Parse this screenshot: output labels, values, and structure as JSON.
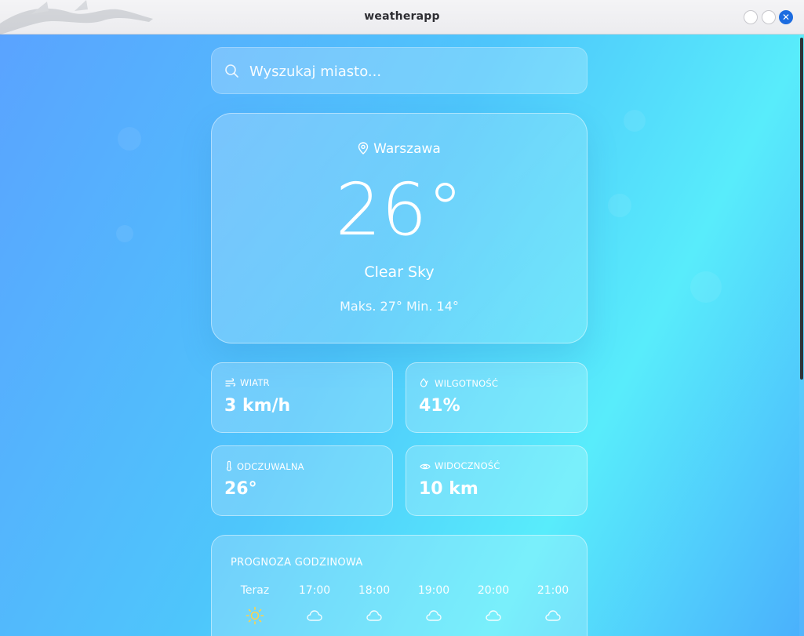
{
  "window": {
    "title": "weatherapp"
  },
  "search": {
    "placeholder": "Wyszukaj miasto...",
    "icon": "search-icon"
  },
  "current": {
    "location_icon": "map-pin-icon",
    "city": "Warszawa",
    "temperature": "26°",
    "condition": "Clear Sky",
    "minmax": "Maks. 27° Min. 14°"
  },
  "stats": [
    {
      "icon": "wind-icon",
      "label": "WIATR",
      "value": "3 km/h"
    },
    {
      "icon": "droplets-icon",
      "label": "WILGOTNOŚĆ",
      "value": "41%"
    },
    {
      "icon": "thermometer-icon",
      "label": "ODCZUWALNA",
      "value": "26°"
    },
    {
      "icon": "eye-icon",
      "label": "WIDOCZNOŚĆ",
      "value": "10 km"
    }
  ],
  "hourly": {
    "title": "PROGNOZA GODZINOWA",
    "items": [
      {
        "time": "Teraz",
        "icon": "sun-icon"
      },
      {
        "time": "17:00",
        "icon": "cloud-icon"
      },
      {
        "time": "18:00",
        "icon": "cloud-icon"
      },
      {
        "time": "19:00",
        "icon": "cloud-icon"
      },
      {
        "time": "20:00",
        "icon": "cloud-icon"
      },
      {
        "time": "21:00",
        "icon": "cloud-icon"
      }
    ]
  },
  "colors": {
    "sun": "#ffd24a",
    "close_button": "#1c6ce0"
  }
}
